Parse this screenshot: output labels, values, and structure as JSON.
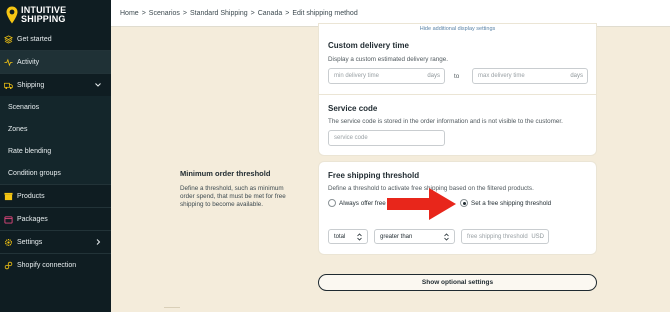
{
  "brand": {
    "name_line1": "INTUITIVE",
    "name_line2": "SHIPPING",
    "accent": "#f6c613"
  },
  "sidebar": {
    "items": [
      {
        "label": "Get started",
        "icon": "layers-icon"
      },
      {
        "label": "Activity",
        "icon": "activity-icon"
      },
      {
        "label": "Shipping",
        "icon": "truck-icon"
      },
      {
        "label": "Scenarios"
      },
      {
        "label": "Zones"
      },
      {
        "label": "Rate blending"
      },
      {
        "label": "Condition groups"
      },
      {
        "label": "Products",
        "icon": "box-icon"
      },
      {
        "label": "Packages",
        "icon": "package-icon"
      },
      {
        "label": "Settings",
        "icon": "gear-icon"
      },
      {
        "label": "Shopify connection",
        "icon": "link-icon"
      }
    ]
  },
  "breadcrumb": [
    "Home",
    "Scenarios",
    "Standard Shipping",
    "Canada",
    "Edit shipping method"
  ],
  "delivery_card": {
    "hide_link": "Hide additional display settings",
    "custom_delivery_title": "Custom delivery time",
    "custom_delivery_desc": "Display a custom estimated delivery range.",
    "min_placeholder": "min delivery time",
    "min_suffix": "days",
    "to_label": "to",
    "max_placeholder": "max delivery time",
    "max_suffix": "days",
    "service_code_title": "Service code",
    "service_code_desc": "The service code is stored in the order information and is not visible to the customer.",
    "service_code_placeholder": "service code"
  },
  "threshold_section": {
    "title": "Minimum order threshold",
    "desc": "Define a threshold, such as minimum order spend, that must be met for free shipping to become available."
  },
  "free_shipping_card": {
    "title": "Free shipping threshold",
    "desc": "Define a threshold to activate free shipping based on the filtered products.",
    "option_always": "Always offer free s",
    "option_threshold": "Set a free shipping threshold",
    "selected": "threshold",
    "select_metric": "total",
    "select_operator": "greater than",
    "threshold_placeholder": "free shipping threshold",
    "threshold_suffix": "USD"
  },
  "optional_button": "Show optional settings",
  "colors": {
    "sidebar_bg": "#0f1d22",
    "page_bg": "#f4ecdb",
    "arrow": "#e8261b"
  }
}
